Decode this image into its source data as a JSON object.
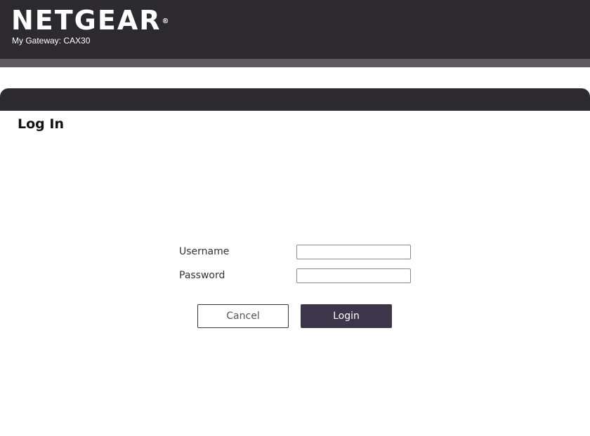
{
  "header": {
    "logo_text": "NETGEAR",
    "logo_mark": "®",
    "gateway_label": "My Gateway: CAX30"
  },
  "page": {
    "title": "Log In"
  },
  "form": {
    "username_label": "Username",
    "username_value": "",
    "password_label": "Password",
    "password_value": ""
  },
  "buttons": {
    "cancel_label": "Cancel",
    "login_label": "Login"
  },
  "colors": {
    "header_bg": "#2d2a2f",
    "subbar_bg": "#5e5a62",
    "login_button_bg": "#3d3549"
  }
}
